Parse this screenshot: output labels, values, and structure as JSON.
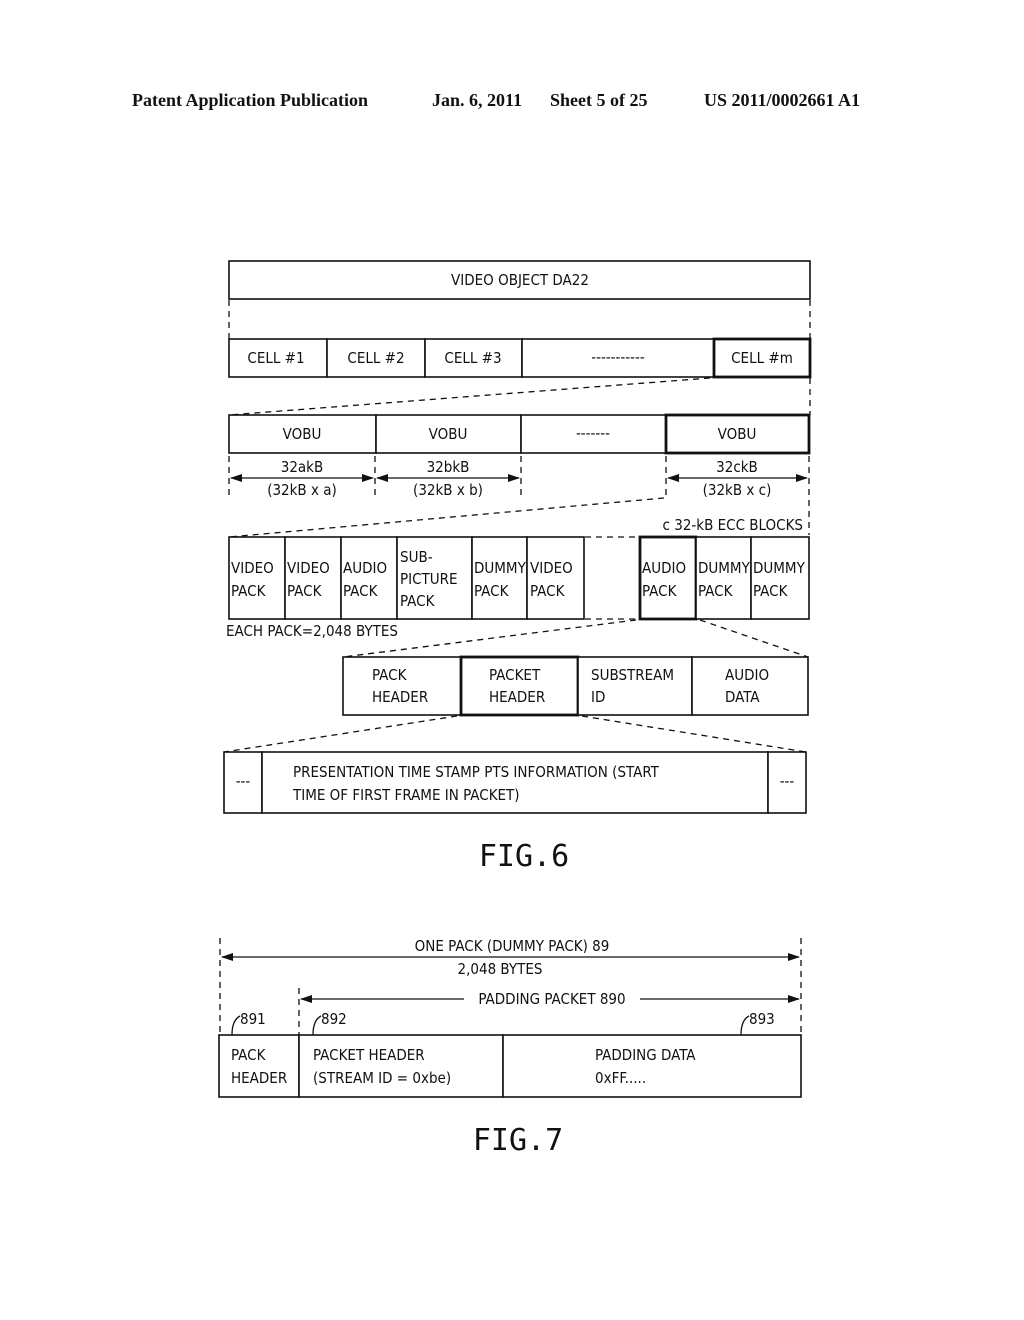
{
  "header": {
    "publication": "Patent Application Publication",
    "date": "Jan. 6, 2011",
    "sheet": "Sheet 5 of 25",
    "number": "US 2011/0002661 A1"
  },
  "fig6": {
    "caption": "FIG.6",
    "video_object": "VIDEO OBJECT DA22",
    "cells": [
      "CELL #1",
      "CELL #2",
      "CELL #3",
      "-----------",
      "CELL #m"
    ],
    "vobus": [
      "VOBU",
      "VOBU",
      "-------",
      "VOBU"
    ],
    "sizes": [
      {
        "top": "32akB",
        "bottom": "(32kB x a)"
      },
      {
        "top": "32bkB",
        "bottom": "(32kB x b)"
      },
      {
        "top": "32ckB",
        "bottom": "(32kB x c)"
      }
    ],
    "ecc_label": "c 32-kB ECC BLOCKS",
    "packs_left": [
      [
        "VIDEO",
        "PACK"
      ],
      [
        "VIDEO",
        "PACK"
      ],
      [
        "AUDIO",
        "PACK"
      ],
      [
        "SUB-",
        "PICTURE",
        "PACK"
      ],
      [
        "DUMMY",
        "PACK"
      ],
      [
        "VIDEO",
        "PACK"
      ]
    ],
    "packs_right": [
      [
        "AUDIO",
        "PACK"
      ],
      [
        "DUMMY",
        "PACK"
      ],
      [
        "DUMMY",
        "PACK"
      ]
    ],
    "each_pack": "EACH PACK=2,048 BYTES",
    "pack_fields": [
      [
        "PACK",
        "HEADER"
      ],
      [
        "PACKET",
        "HEADER"
      ],
      [
        "SUBSTREAM",
        "ID"
      ],
      [
        "AUDIO",
        "DATA"
      ]
    ],
    "pts_side": "---",
    "pts_line1": "PRESENTATION TIME STAMP PTS INFORMATION (START",
    "pts_line2": "TIME OF FIRST FRAME IN PACKET)"
  },
  "fig7": {
    "caption": "FIG.7",
    "one_pack": "ONE PACK (DUMMY PACK) 89",
    "bytes": "2,048 BYTES",
    "padding_packet": "PADDING PACKET 890",
    "refs": [
      "891",
      "892",
      "893"
    ],
    "fields": [
      [
        "PACK",
        "HEADER"
      ],
      [
        "PACKET HEADER",
        "(STREAM ID = 0xbe)"
      ],
      [
        "PADDING DATA",
        "0xFF....."
      ]
    ]
  }
}
